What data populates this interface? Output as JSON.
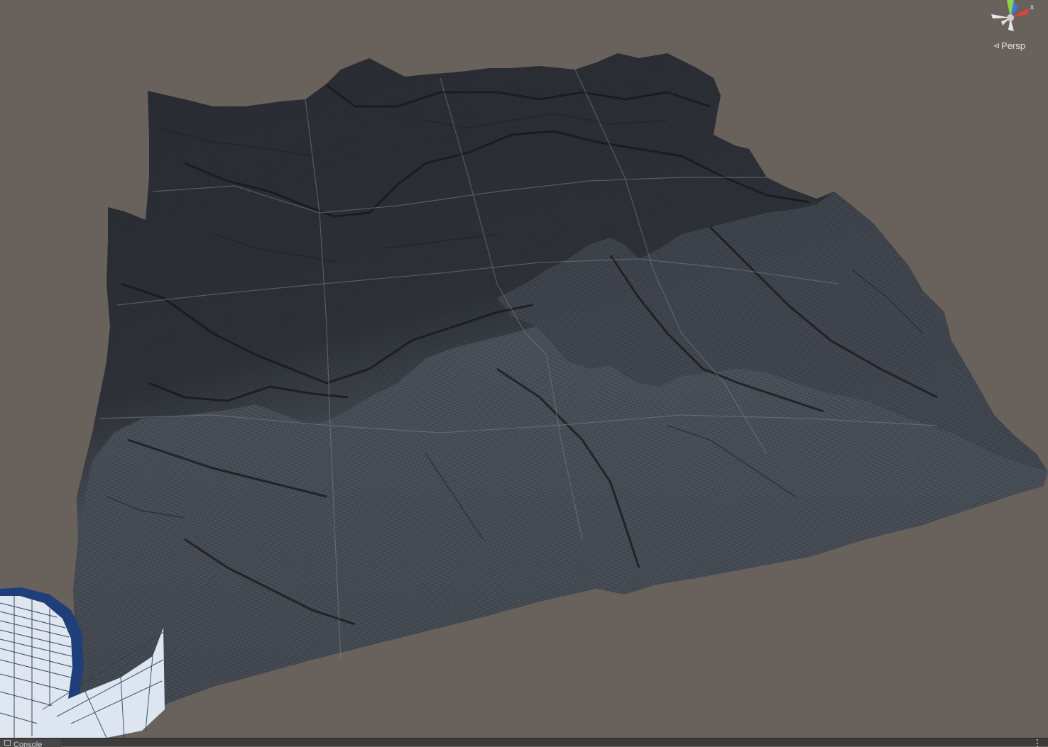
{
  "scene_view": {
    "projection_label": "Persp",
    "projection_icon": "perspective-icon",
    "background_color": "#69615b",
    "terrain_color": "#4d535c",
    "terrain_dark_color": "#2b2e33",
    "wireframe_color": "#1f2126"
  },
  "gizmo": {
    "x_axis_label": "x",
    "x_axis_color": "#e2413a",
    "y_axis_color": "#8ed14b",
    "z_axis_color": "#3c7be8",
    "icon": "orientation-gizmo-icon"
  },
  "bottom_panel": {
    "console_tab_label": "Console",
    "console_icon": "console-icon",
    "menu_icon": "kebab-menu-icon"
  }
}
